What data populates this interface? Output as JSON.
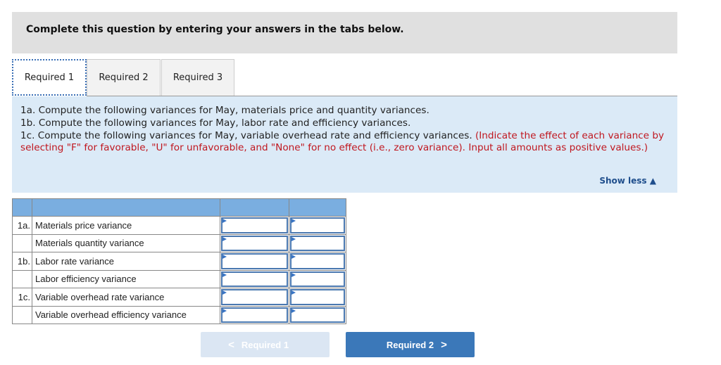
{
  "banner": {
    "text": "Complete this question by entering your answers in the tabs below."
  },
  "tabs": [
    {
      "label": "Required 1",
      "active": true
    },
    {
      "label": "Required 2",
      "active": false
    },
    {
      "label": "Required 3",
      "active": false
    }
  ],
  "instructions": {
    "line1": "1a. Compute the following variances for May, materials price and quantity variances.",
    "line2": "1b. Compute the following variances for May, labor rate and efficiency variances.",
    "line3_black": "1c. Compute the following variances for May, variable overhead rate and efficiency variances. ",
    "line3_red": "(Indicate the effect of each variance by selecting \"F\" for favorable, \"U\" for unfavorable, and \"None\" for no effect (i.e., zero variance). Input all amounts as positive values.)",
    "show_less": "Show less"
  },
  "table": {
    "rows": [
      {
        "num": "1a.",
        "label": "Materials price variance",
        "amount": "",
        "effect": ""
      },
      {
        "num": "",
        "label": "Materials quantity variance",
        "amount": "",
        "effect": ""
      },
      {
        "num": "1b.",
        "label": "Labor rate variance",
        "amount": "",
        "effect": ""
      },
      {
        "num": "",
        "label": "Labor efficiency variance",
        "amount": "",
        "effect": ""
      },
      {
        "num": "1c.",
        "label": "Variable overhead rate variance",
        "amount": "",
        "effect": ""
      },
      {
        "num": "",
        "label": "Variable overhead efficiency variance",
        "amount": "",
        "effect": ""
      }
    ]
  },
  "nav": {
    "prev_label": "Required 1",
    "next_label": "Required 2"
  }
}
